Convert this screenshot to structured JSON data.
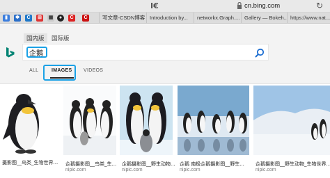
{
  "browser": {
    "reader_icon": "I€",
    "url": "cn.bing.com",
    "reload_icon": "reload-icon"
  },
  "tabs": [
    {
      "label": "写文章-CSDN博客"
    },
    {
      "label": "Introduction by..."
    },
    {
      "label": "networkx.Graph...."
    },
    {
      "label": "Gallery — Bokeh..."
    },
    {
      "label": "https://www.nat..."
    }
  ],
  "bing": {
    "region_tabs": [
      "国内版",
      "国际版"
    ],
    "query": "企鹅",
    "nav": {
      "all": "ALL",
      "images": "IMAGES",
      "videos": "VIDEOS"
    },
    "colors": {
      "highlight": "#1aa1e6",
      "bing_teal": "#008373"
    }
  },
  "results": [
    {
      "caption": "摄影图__鸟类_生物世界...",
      "source": ""
    },
    {
      "caption": "企鹅摄影图__鸟类_生...",
      "source": "nipic.com"
    },
    {
      "caption": "企鹅摄影图__野生动物...",
      "source": "nipic.com"
    },
    {
      "caption": "企鹅 南极企鹅摄影图__野生...",
      "source": "nipic.com"
    },
    {
      "caption": "企鹅摄影图__野生动物_生物世界...",
      "source": "nipic.com"
    }
  ]
}
